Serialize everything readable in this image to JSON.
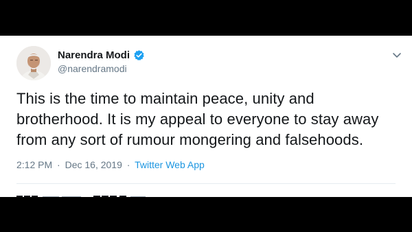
{
  "tweet": {
    "author": {
      "display_name": "Narendra Modi",
      "handle": "@narendramodi",
      "verified_icon": "verified-badge-icon",
      "avatar_icon": "profile-photo"
    },
    "text": "This is the time to maintain peace, unity and brotherhood. It is my appeal to everyone to stay away from any sort of rumour mongering and falsehoods.",
    "time": "2:12 PM",
    "separator": "·",
    "date": "Dec 16, 2019",
    "source": "Twitter Web App",
    "menu_icon": "chevron-down-icon"
  },
  "colors": {
    "background": "#000000",
    "card": "#ffffff",
    "text_primary": "#14171a",
    "text_secondary": "#657786",
    "accent": "#1b95e0",
    "verified": "#1da1f2"
  }
}
